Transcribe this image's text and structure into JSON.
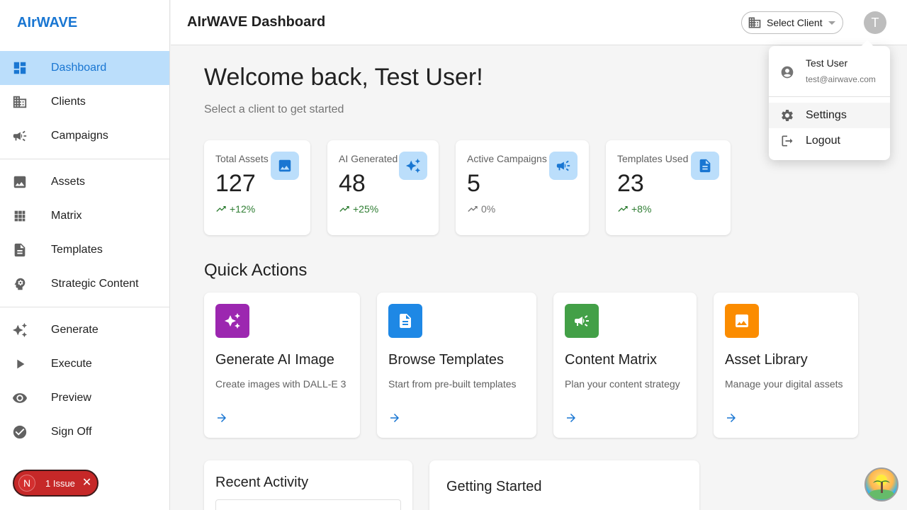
{
  "app": {
    "brand": "AIrWAVE",
    "title": "AIrWAVE Dashboard"
  },
  "sidebar": {
    "groups": [
      [
        {
          "label": "Dashboard",
          "icon": "dashboard-icon",
          "active": true
        },
        {
          "label": "Clients",
          "icon": "building-icon"
        },
        {
          "label": "Campaigns",
          "icon": "megaphone-icon"
        }
      ],
      [
        {
          "label": "Assets",
          "icon": "image-icon"
        },
        {
          "label": "Matrix",
          "icon": "grid-icon"
        },
        {
          "label": "Templates",
          "icon": "document-icon"
        },
        {
          "label": "Strategic Content",
          "icon": "brain-icon"
        }
      ],
      [
        {
          "label": "Generate",
          "icon": "sparkle-icon"
        },
        {
          "label": "Execute",
          "icon": "play-icon"
        },
        {
          "label": "Preview",
          "icon": "eye-icon"
        },
        {
          "label": "Sign Off",
          "icon": "check-circle-icon"
        }
      ]
    ]
  },
  "header": {
    "client_select_label": "Select Client",
    "avatar_initial": "T"
  },
  "welcome": {
    "title": "Welcome back, Test User!",
    "subtitle": "Select a client to get started"
  },
  "stats": [
    {
      "label": "Total Assets",
      "value": "127",
      "trend": "+12%",
      "trend_dir": "up",
      "icon": "image-icon"
    },
    {
      "label": "AI Generated",
      "value": "48",
      "trend": "+25%",
      "trend_dir": "up",
      "icon": "sparkle-icon"
    },
    {
      "label": "Active Campaigns",
      "value": "5",
      "trend": "0%",
      "trend_dir": "flat",
      "icon": "megaphone-icon"
    },
    {
      "label": "Templates Used",
      "value": "23",
      "trend": "+8%",
      "trend_dir": "up",
      "icon": "document-icon"
    }
  ],
  "quick_actions": {
    "title": "Quick Actions",
    "items": [
      {
        "title": "Generate AI Image",
        "desc": "Create images with DALL-E 3",
        "icon": "sparkle-icon",
        "color": "#9c27b0"
      },
      {
        "title": "Browse Templates",
        "desc": "Start from pre-built templates",
        "icon": "document-icon",
        "color": "#1e88e5"
      },
      {
        "title": "Content Matrix",
        "desc": "Plan your content strategy",
        "icon": "megaphone-icon",
        "color": "#43a047"
      },
      {
        "title": "Asset Library",
        "desc": "Manage your digital assets",
        "icon": "image-icon",
        "color": "#fb8c00"
      }
    ]
  },
  "recent_activity": {
    "title": "Recent Activity"
  },
  "getting_started": {
    "title": "Getting Started"
  },
  "user_menu": {
    "name": "Test User",
    "email": "test@airwave.com",
    "items": [
      {
        "label": "Settings",
        "icon": "gear-icon"
      },
      {
        "label": "Logout",
        "icon": "logout-icon"
      }
    ]
  },
  "issue_badge": {
    "initial": "N",
    "text": "1 Issue",
    "close": "✕"
  },
  "colors": {
    "primary": "#1976d2",
    "active_bg": "#bbdefb",
    "trend_up": "#2e7d32",
    "issue": "#c62828"
  }
}
